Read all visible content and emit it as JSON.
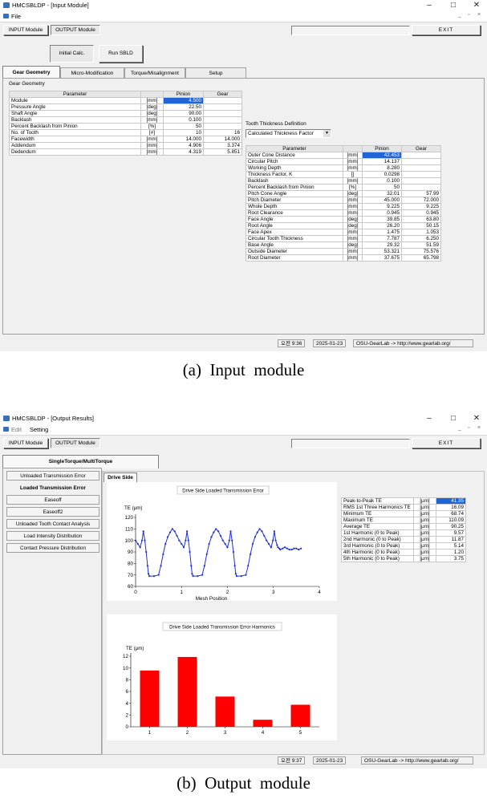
{
  "input_window": {
    "title": "HMCSBLDP - [Input Module]",
    "menu": [
      "File"
    ],
    "toolbar": {
      "input_module": "INPUT Module",
      "output_module": "OUTPUT Module",
      "exit": "EXIT"
    },
    "buttons": {
      "initial_calc": "Initial Calc.",
      "run_sbld": "Run SBLD"
    },
    "tabs": [
      "Gear Geometry",
      "Micro-Modification",
      "Torque/Misalignment",
      "Setup"
    ],
    "group_title": "Gear Geometry",
    "geometry_table": {
      "headers": [
        "Parameter",
        "",
        "Pinion",
        "Gear"
      ],
      "rows": [
        [
          "Module",
          "[mm]",
          "4.500",
          ""
        ],
        [
          "Pressure Angle",
          "[deg]",
          "22.50",
          ""
        ],
        [
          "Shaft Angle",
          "[deg]",
          "90.00",
          ""
        ],
        [
          "Backlash",
          "[mm]",
          "0.100",
          ""
        ],
        [
          "Percent Backlash from Pinion",
          "[%]",
          "50",
          ""
        ],
        [
          "No. of Tooth",
          "[#]",
          "10",
          "16"
        ],
        [
          "Facewidth",
          "[mm]",
          "14.000",
          "14.000"
        ],
        [
          "Addendum",
          "[mm]",
          "4.906",
          "3.374"
        ],
        [
          "Dedendum",
          "[mm]",
          "4.319",
          "5.851"
        ]
      ]
    },
    "thickness": {
      "label": "Tooth Thickness Definition",
      "selected": "Calculated Thickness Factor"
    },
    "result_table": {
      "headers": [
        "Parameter",
        "",
        "Pinion",
        "Gear"
      ],
      "rows": [
        [
          "Outer Cone Distance",
          "[mm]",
          "42.453",
          ""
        ],
        [
          "Circular Pitch",
          "[mm]",
          "14.137",
          ""
        ],
        [
          "Working Depth",
          "[mm]",
          "8.280",
          ""
        ],
        [
          "Thickness Factor, K",
          "[]",
          "0.0298",
          ""
        ],
        [
          "Backlash",
          "[mm]",
          "0.100",
          ""
        ],
        [
          "Percent Backlash from Pinion",
          "[%]",
          "50",
          ""
        ],
        [
          "Pitch Cone Angle",
          "[deg]",
          "32.01",
          "57.99"
        ],
        [
          "Pitch Diameter",
          "[mm]",
          "45.000",
          "72.000"
        ],
        [
          "Whole Depth",
          "[mm]",
          "9.225",
          "9.225"
        ],
        [
          "Root Clearance",
          "[mm]",
          "0.945",
          "0.945"
        ],
        [
          "Face Angle",
          "[deg]",
          "39.85",
          "63.80"
        ],
        [
          "Root Angle",
          "[deg]",
          "26.20",
          "50.15"
        ],
        [
          "Face Apex",
          "[mm]",
          "1.475",
          "1.053"
        ],
        [
          "Circular Tooth Thickness",
          "[mm]",
          "7.787",
          "6.250"
        ],
        [
          "Base Angle",
          "[deg]",
          "29.32",
          "51.59"
        ],
        [
          "Outside Diameter",
          "[mm]",
          "53.321",
          "75.576"
        ],
        [
          "Root Diameter",
          "[mm]",
          "37.675",
          "65.798"
        ]
      ]
    },
    "status": {
      "time": "오전 9:36",
      "date": "2025-01-23",
      "link": "OSU-GearLab -> http://www.gearlab.org/"
    }
  },
  "caption_a": "(a)  Input  module",
  "output_window": {
    "title": "HMCSBLDP - [Output Results]",
    "menu": [
      "Edit",
      "Setting"
    ],
    "toolbar": {
      "input_module": "INPUT Module",
      "output_module": "OUTPUT Module",
      "exit": "EXIT"
    },
    "main_tab": "SingleTorque/MultiTorque",
    "nav": [
      "Unloaded Transmission Error",
      "Loaded Transmission Error",
      "Easeoff",
      "Easeoff2",
      "Unloaded Tooth Contact Analysis",
      "Load Intensity Distribution",
      "Contact Pressure Distribution"
    ],
    "sub_tab": "Drive Side",
    "summary_table": {
      "rows": [
        [
          "Peak-to-Peak TE",
          "[μm]",
          "41.35"
        ],
        [
          "RMS 1st Three Harmonics TE",
          "[μm]",
          "16.09"
        ],
        [
          "Minimum TE",
          "[μm]",
          "68.74"
        ],
        [
          "Maximum TE",
          "[μm]",
          "110.09"
        ],
        [
          "Average TE",
          "[μm]",
          "90.25"
        ],
        [
          "1st Harmonic (0 to Peak)",
          "[μm]",
          "9.57"
        ],
        [
          "2nd Harmonic (0 to Peak)",
          "[μm]",
          "11.87"
        ],
        [
          "3rd Harmonic (0 to Peak)",
          "[μm]",
          "5.14"
        ],
        [
          "4th Harmonic (0 to Peak)",
          "[μm]",
          "1.20"
        ],
        [
          "5th Harmonic (0 to Peak)",
          "[μm]",
          "3.75"
        ]
      ]
    },
    "status": {
      "time": "오전 9:37",
      "date": "2025-01-23",
      "link": "OSU-GearLab -> http://www.gearlab.org/"
    }
  },
  "caption_b": "(b)  Output  module",
  "chart_data": [
    {
      "type": "line",
      "title": "Drive Side Loaded Transmission Error",
      "ylabel": "TE (μm)",
      "xlabel": "Mesh Position",
      "xlim": [
        0,
        4
      ],
      "ylim": [
        60,
        120
      ],
      "xticks": [
        0,
        1,
        2,
        3,
        4
      ],
      "yticks": [
        60,
        70,
        80,
        90,
        100,
        110,
        120
      ],
      "color": "#1e2fd6",
      "series": [
        {
          "x": [
            0,
            0.05,
            0.1,
            0.14,
            0.17,
            0.2,
            0.23,
            0.26,
            0.28,
            0.3,
            0.4,
            0.5,
            0.55,
            0.6,
            0.65,
            0.7,
            0.75,
            0.8,
            0.85,
            0.9,
            0.95,
            1.0,
            1.05,
            1.09,
            1.12,
            1.15,
            1.18,
            1.21,
            1.23,
            1.25,
            1.35,
            1.45,
            1.5,
            1.55,
            1.6,
            1.65,
            1.7,
            1.75,
            1.8,
            1.85,
            1.9,
            1.95,
            2.0,
            2.04,
            2.07,
            2.1,
            2.13,
            2.16,
            2.18,
            2.2,
            2.3,
            2.4,
            2.45,
            2.5,
            2.55,
            2.6,
            2.65,
            2.7,
            2.75,
            2.8,
            2.85,
            2.9,
            2.95,
            2.99,
            3.02,
            3.05,
            3.08,
            3.1,
            3.13,
            3.15,
            3.2,
            3.25,
            3.3,
            3.35,
            3.4,
            3.45,
            3.5,
            3.55,
            3.6
          ],
          "y": [
            100,
            97,
            94,
            100,
            108,
            100,
            90,
            78,
            71,
            69,
            69,
            70,
            78,
            88,
            97,
            103,
            107,
            110,
            108,
            104,
            100,
            97,
            94,
            100,
            108,
            100,
            90,
            78,
            71,
            69,
            69,
            70,
            78,
            88,
            97,
            103,
            107,
            110,
            108,
            104,
            100,
            97,
            94,
            100,
            108,
            100,
            90,
            78,
            71,
            69,
            69,
            70,
            78,
            88,
            97,
            103,
            107,
            110,
            108,
            104,
            100,
            97,
            94,
            100,
            108,
            100,
            96,
            94,
            93,
            92,
            93,
            94,
            93,
            92,
            92,
            93,
            93,
            92,
            93
          ]
        }
      ]
    },
    {
      "type": "bar",
      "title": "Drive Side Loaded Transmission Error Harmonics",
      "ylabel": "TE (μm)",
      "categories": [
        "1",
        "2",
        "3",
        "4",
        "5"
      ],
      "values": [
        9.57,
        11.87,
        5.14,
        1.2,
        3.75
      ],
      "ylim": [
        0,
        12
      ],
      "yticks": [
        0,
        2,
        4,
        6,
        8,
        10,
        12
      ],
      "color": "#ff0000"
    }
  ]
}
